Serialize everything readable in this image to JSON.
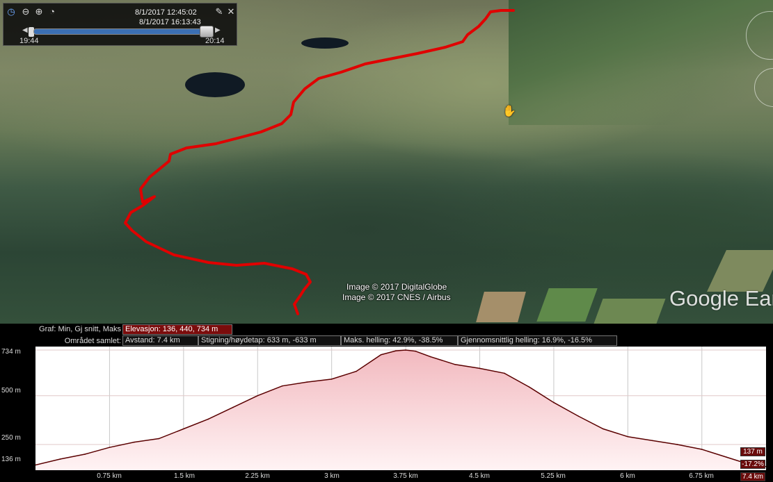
{
  "time_slider": {
    "start_datetime": "8/1/2017  12:45:02",
    "end_datetime": "8/1/2017  16:13:43",
    "left_time": "19:44",
    "right_time": "20:14",
    "position_fraction": 0.96,
    "buttons": [
      "clock-icon",
      "zoom-out-icon",
      "zoom-in-icon",
      "settings-icon",
      "wrench-icon",
      "close-icon"
    ]
  },
  "map": {
    "credits": [
      "Image © 2017 DigitalGlobe",
      "Image © 2017 CNES / Airbus"
    ],
    "brand": "Google Ear",
    "track_color": "#e00000"
  },
  "profile": {
    "graph_label": "Graf: Min, Gj snitt, Maks",
    "elevation_cell": "Elevasjon: 136, 440, 734 m",
    "range_label": "Området samlet:",
    "distance_cell": "Avstand: 7.4 km",
    "climb_cell": "Stigning/høydetap: 633 m, -633 m",
    "max_slope_cell": "Maks. helling: 42.9%, -38.5%",
    "avg_slope_cell": "Gjennomsnittlig helling: 16.9%, -16.5%",
    "cursor_elevation": "137 m",
    "cursor_slope": "-17.2%",
    "cursor_distance": "7.4 km",
    "fill_color": "#f2b9bf",
    "line_color": "#5a0000"
  },
  "chart_data": {
    "type": "area",
    "xlabel": "",
    "ylabel": "",
    "xlim": [
      0,
      7.4
    ],
    "ylim": [
      136,
      734
    ],
    "x_ticks": [
      "0.75 km",
      "1.5 km",
      "2.25 km",
      "3 km",
      "3.75 km",
      "4.5 km",
      "5.25 km",
      "6 km",
      "6.75 km"
    ],
    "y_ticks": [
      "734 m",
      "500 m",
      "250 m",
      "136 m"
    ],
    "y_tick_values": [
      734,
      500,
      250,
      136
    ],
    "x": [
      0,
      0.25,
      0.5,
      0.75,
      1.0,
      1.25,
      1.5,
      1.75,
      2.0,
      2.25,
      2.5,
      2.75,
      3.0,
      3.25,
      3.5,
      3.65,
      3.75,
      3.85,
      4.0,
      4.25,
      4.5,
      4.75,
      5.0,
      5.25,
      5.5,
      5.75,
      6.0,
      6.25,
      6.5,
      6.75,
      7.0,
      7.25,
      7.4
    ],
    "y": [
      145,
      175,
      200,
      235,
      262,
      280,
      330,
      380,
      440,
      500,
      550,
      570,
      585,
      625,
      710,
      730,
      734,
      728,
      700,
      660,
      640,
      615,
      545,
      465,
      395,
      330,
      290,
      270,
      250,
      225,
      185,
      145,
      137
    ],
    "grid": true
  }
}
